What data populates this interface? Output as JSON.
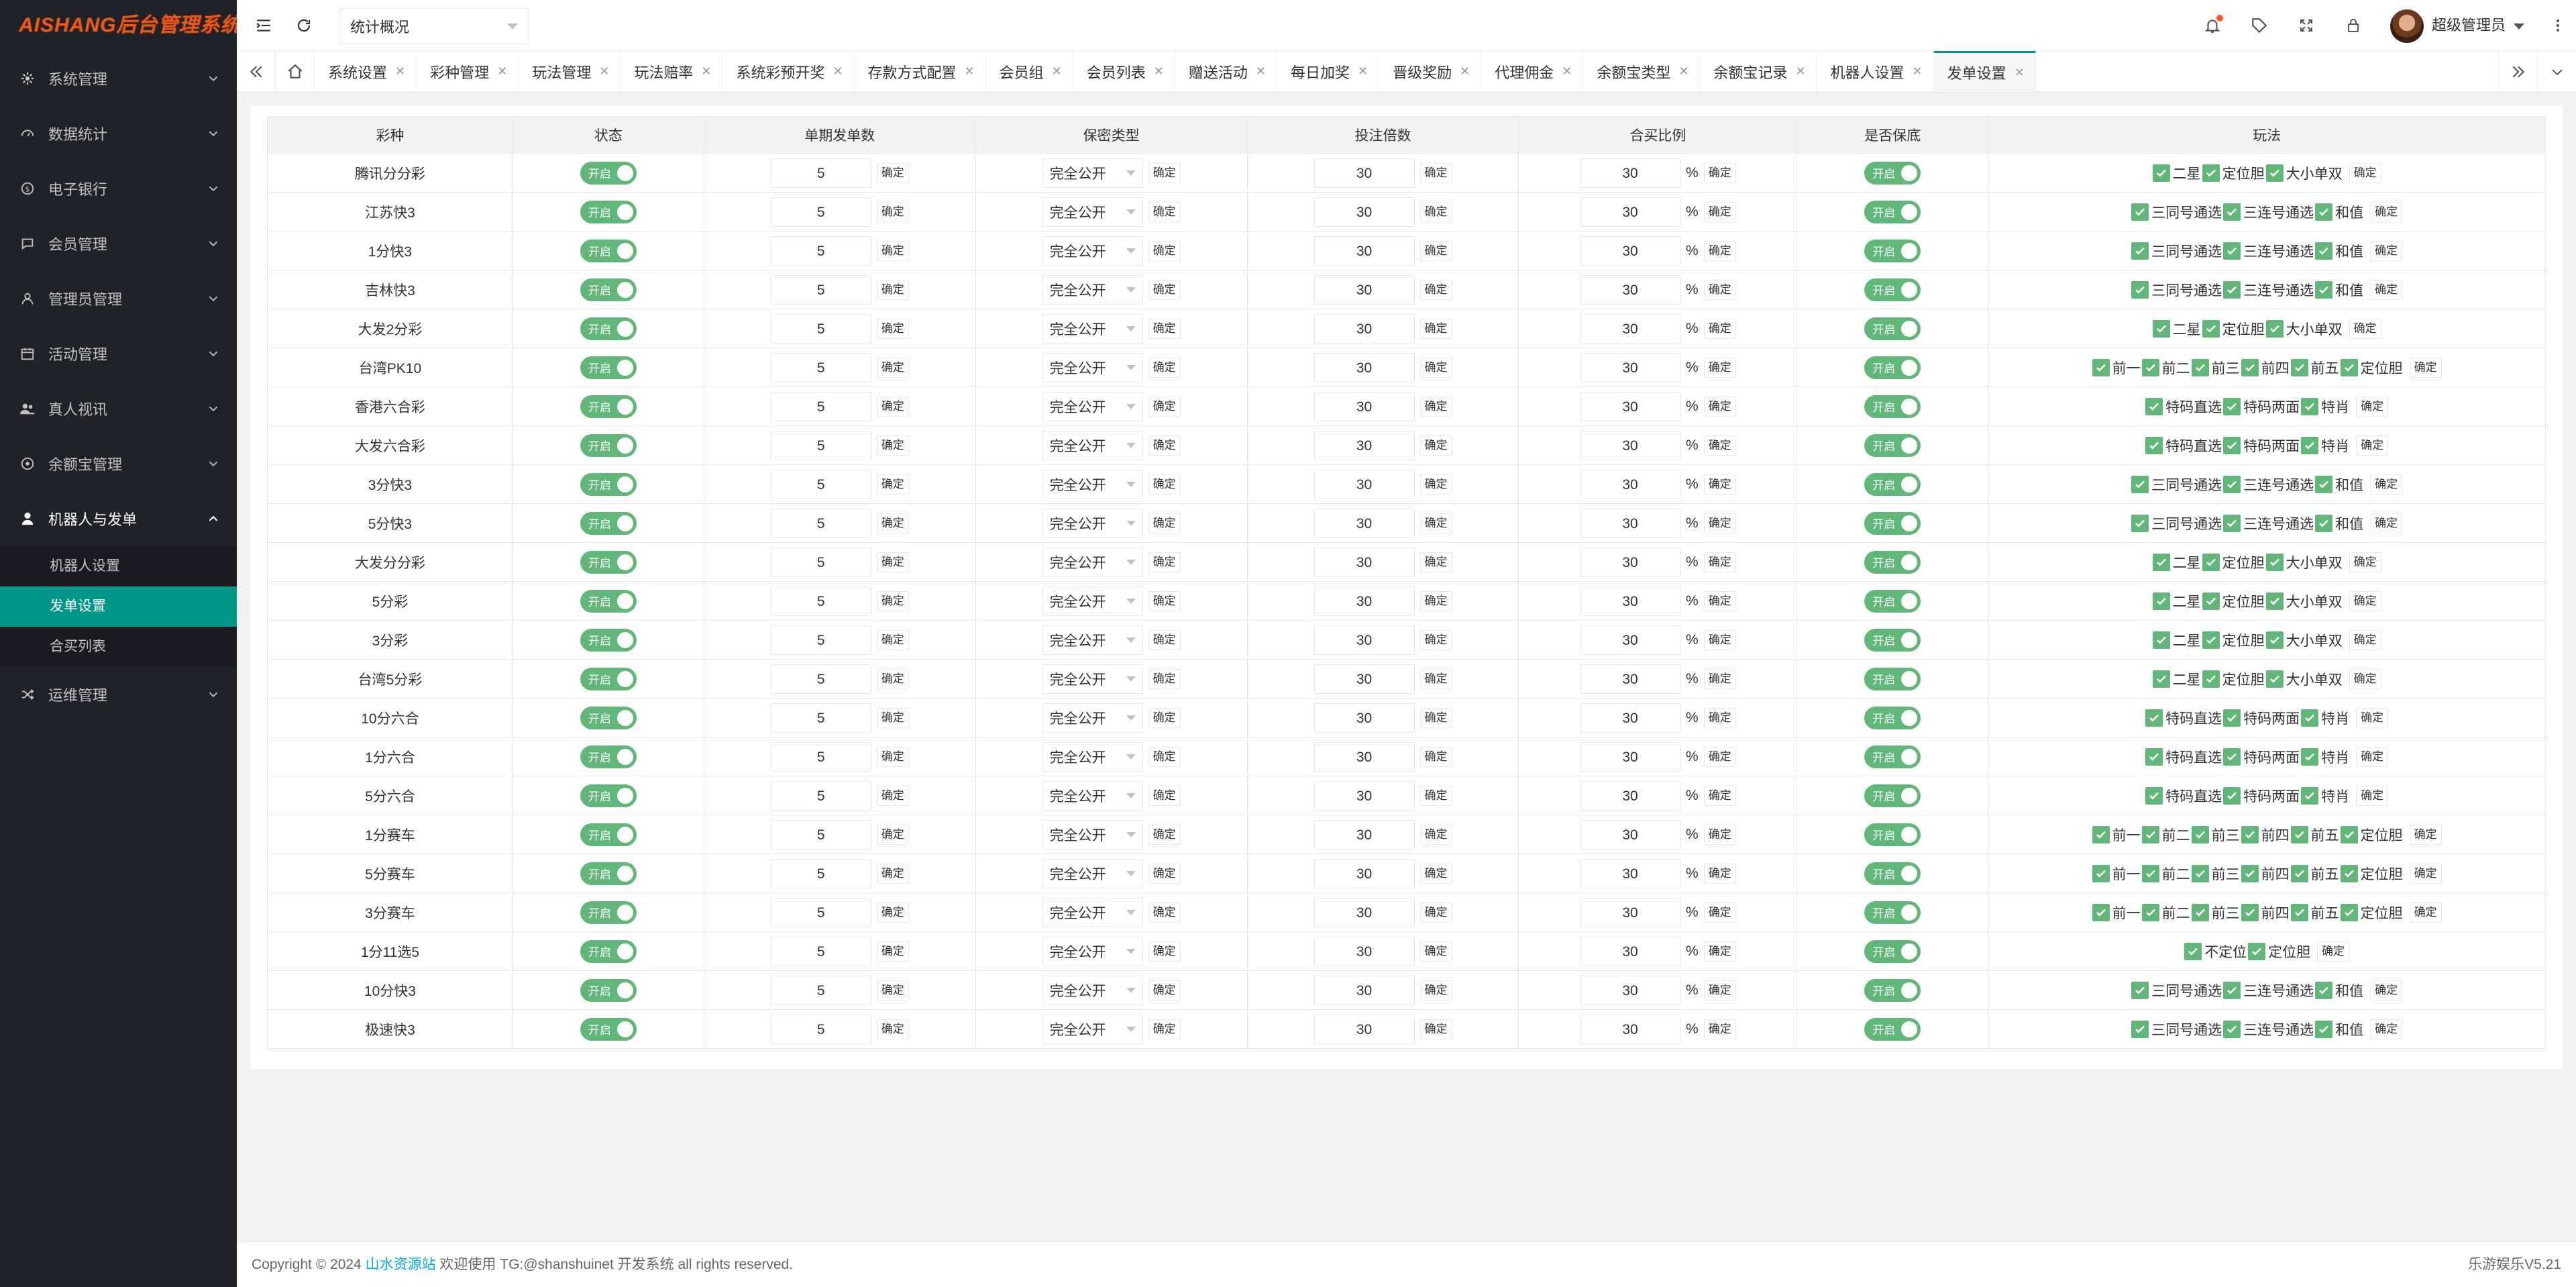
{
  "app": {
    "logo_text": "AISHANG后台管理系统"
  },
  "sidebar": {
    "items": [
      {
        "label": "系统管理",
        "icon": "gear-icon"
      },
      {
        "label": "数据统计",
        "icon": "gauge-icon"
      },
      {
        "label": "电子银行",
        "icon": "dollar-icon"
      },
      {
        "label": "会员管理",
        "icon": "chat-icon"
      },
      {
        "label": "管理员管理",
        "icon": "user-icon"
      },
      {
        "label": "活动管理",
        "icon": "calendar-icon"
      },
      {
        "label": "真人视讯",
        "icon": "users-icon"
      },
      {
        "label": "余额宝管理",
        "icon": "globe-icon"
      },
      {
        "label": "机器人与发单",
        "icon": "person-icon",
        "open": true
      },
      {
        "label": "运维管理",
        "icon": "shuffle-icon"
      }
    ],
    "sub_items": [
      {
        "label": "机器人设置"
      },
      {
        "label": "发单设置",
        "active": true
      },
      {
        "label": "合买列表"
      }
    ]
  },
  "header": {
    "select_value": "统计概况",
    "admin_name": "超级管理员"
  },
  "tabs": [
    "系统设置",
    "彩种管理",
    "玩法管理",
    "玩法赔率",
    "系统彩预开奖",
    "存款方式配置",
    "会员组",
    "会员列表",
    "赠送活动",
    "每日加奖",
    "晋级奖励",
    "代理佣金",
    "余额宝类型",
    "余额宝记录",
    "机器人设置",
    "发单设置"
  ],
  "active_tab": "发单设置",
  "table": {
    "headers": [
      "彩种",
      "状态",
      "单期发单数",
      "保密类型",
      "投注倍数",
      "合买比例",
      "是否保底",
      "玩法"
    ],
    "switch_label": "开启",
    "confirm_label": "确定",
    "percent": "%",
    "rows": [
      {
        "name": "腾讯分分彩",
        "count": "5",
        "secret": "完全公开",
        "mult": "30",
        "ratio": "30",
        "plays": [
          "二星",
          "定位胆",
          "大小单双"
        ]
      },
      {
        "name": "江苏快3",
        "count": "5",
        "secret": "完全公开",
        "mult": "30",
        "ratio": "30",
        "plays": [
          "三同号通选",
          "三连号通选",
          "和值"
        ]
      },
      {
        "name": "1分快3",
        "count": "5",
        "secret": "完全公开",
        "mult": "30",
        "ratio": "30",
        "plays": [
          "三同号通选",
          "三连号通选",
          "和值"
        ]
      },
      {
        "name": "吉林快3",
        "count": "5",
        "secret": "完全公开",
        "mult": "30",
        "ratio": "30",
        "plays": [
          "三同号通选",
          "三连号通选",
          "和值"
        ]
      },
      {
        "name": "大发2分彩",
        "count": "5",
        "secret": "完全公开",
        "mult": "30",
        "ratio": "30",
        "plays": [
          "二星",
          "定位胆",
          "大小单双"
        ]
      },
      {
        "name": "台湾PK10",
        "count": "5",
        "secret": "完全公开",
        "mult": "30",
        "ratio": "30",
        "plays": [
          "前一",
          "前二",
          "前三",
          "前四",
          "前五",
          "定位胆"
        ]
      },
      {
        "name": "香港六合彩",
        "count": "5",
        "secret": "完全公开",
        "mult": "30",
        "ratio": "30",
        "plays": [
          "特码直选",
          "特码两面",
          "特肖"
        ]
      },
      {
        "name": "大发六合彩",
        "count": "5",
        "secret": "完全公开",
        "mult": "30",
        "ratio": "30",
        "plays": [
          "特码直选",
          "特码两面",
          "特肖"
        ]
      },
      {
        "name": "3分快3",
        "count": "5",
        "secret": "完全公开",
        "mult": "30",
        "ratio": "30",
        "plays": [
          "三同号通选",
          "三连号通选",
          "和值"
        ]
      },
      {
        "name": "5分快3",
        "count": "5",
        "secret": "完全公开",
        "mult": "30",
        "ratio": "30",
        "plays": [
          "三同号通选",
          "三连号通选",
          "和值"
        ]
      },
      {
        "name": "大发分分彩",
        "count": "5",
        "secret": "完全公开",
        "mult": "30",
        "ratio": "30",
        "plays": [
          "二星",
          "定位胆",
          "大小单双"
        ]
      },
      {
        "name": "5分彩",
        "count": "5",
        "secret": "完全公开",
        "mult": "30",
        "ratio": "30",
        "plays": [
          "二星",
          "定位胆",
          "大小单双"
        ]
      },
      {
        "name": "3分彩",
        "count": "5",
        "secret": "完全公开",
        "mult": "30",
        "ratio": "30",
        "plays": [
          "二星",
          "定位胆",
          "大小单双"
        ]
      },
      {
        "name": "台湾5分彩",
        "count": "5",
        "secret": "完全公开",
        "mult": "30",
        "ratio": "30",
        "plays": [
          "二星",
          "定位胆",
          "大小单双"
        ]
      },
      {
        "name": "10分六合",
        "count": "5",
        "secret": "完全公开",
        "mult": "30",
        "ratio": "30",
        "plays": [
          "特码直选",
          "特码两面",
          "特肖"
        ]
      },
      {
        "name": "1分六合",
        "count": "5",
        "secret": "完全公开",
        "mult": "30",
        "ratio": "30",
        "plays": [
          "特码直选",
          "特码两面",
          "特肖"
        ]
      },
      {
        "name": "5分六合",
        "count": "5",
        "secret": "完全公开",
        "mult": "30",
        "ratio": "30",
        "plays": [
          "特码直选",
          "特码两面",
          "特肖"
        ]
      },
      {
        "name": "1分赛车",
        "count": "5",
        "secret": "完全公开",
        "mult": "30",
        "ratio": "30",
        "plays": [
          "前一",
          "前二",
          "前三",
          "前四",
          "前五",
          "定位胆"
        ]
      },
      {
        "name": "5分赛车",
        "count": "5",
        "secret": "完全公开",
        "mult": "30",
        "ratio": "30",
        "plays": [
          "前一",
          "前二",
          "前三",
          "前四",
          "前五",
          "定位胆"
        ]
      },
      {
        "name": "3分赛车",
        "count": "5",
        "secret": "完全公开",
        "mult": "30",
        "ratio": "30",
        "plays": [
          "前一",
          "前二",
          "前三",
          "前四",
          "前五",
          "定位胆"
        ]
      },
      {
        "name": "1分11选5",
        "count": "5",
        "secret": "完全公开",
        "mult": "30",
        "ratio": "30",
        "plays": [
          "不定位",
          "定位胆"
        ]
      },
      {
        "name": "10分快3",
        "count": "5",
        "secret": "完全公开",
        "mult": "30",
        "ratio": "30",
        "plays": [
          "三同号通选",
          "三连号通选",
          "和值"
        ]
      },
      {
        "name": "极速快3",
        "count": "5",
        "secret": "完全公开",
        "mult": "30",
        "ratio": "30",
        "plays": [
          "三同号通选",
          "三连号通选",
          "和值"
        ]
      }
    ]
  },
  "footer": {
    "prefix": "Copyright © 2024 ",
    "link": "山水资源站",
    "suffix": " 欢迎使用 TG:@shanshuinet 开发系统 all rights reserved.",
    "version": "乐游娱乐V5.21"
  },
  "colors": {
    "accent": "#009688",
    "switch_on": "#5fb878",
    "sidebar_bg": "#20222a",
    "link": "#01aaed"
  }
}
